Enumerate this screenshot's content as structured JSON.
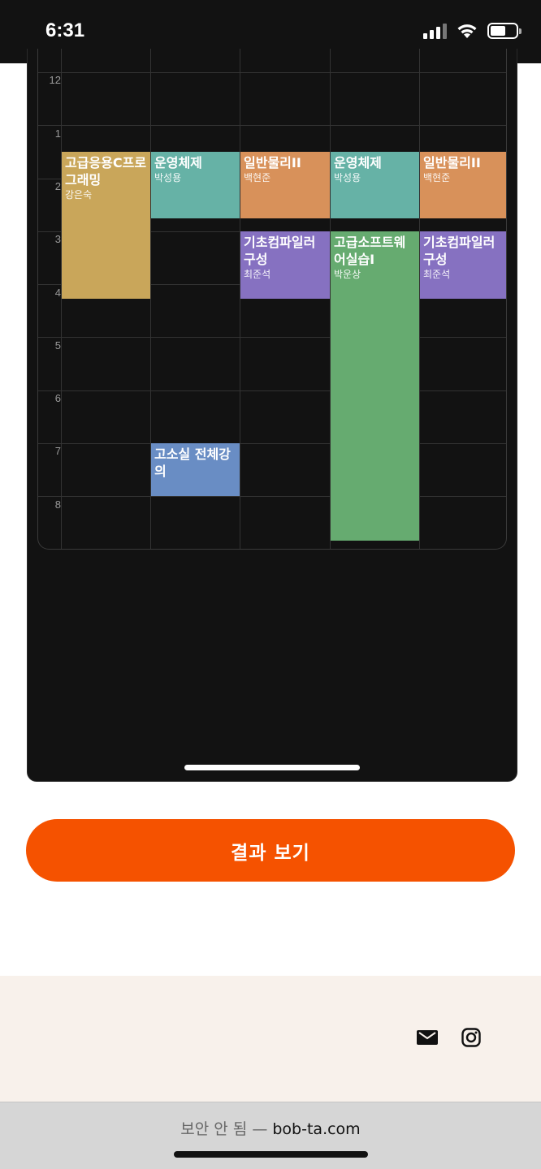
{
  "status_bar": {
    "time": "6:31"
  },
  "timetable": {
    "hours": [
      "12",
      "1",
      "2",
      "3",
      "4",
      "5",
      "6",
      "7",
      "8"
    ],
    "courses": [
      {
        "name": "고급응용C프로그래밍",
        "professor": "강은숙",
        "color": "#c9a65a"
      },
      {
        "name": "운영체제",
        "professor": "박성용",
        "color": "#66b2a6"
      },
      {
        "name": "일반물리II",
        "professor": "백현준",
        "color": "#d8915a"
      },
      {
        "name": "운영체제",
        "professor": "박성용",
        "color": "#66b2a6"
      },
      {
        "name": "일반물리II",
        "professor": "백현준",
        "color": "#d8915a"
      },
      {
        "name": "기초컴파일러구성",
        "professor": "최준석",
        "color": "#8671c1"
      },
      {
        "name": "고급소프트웨어실습I",
        "professor": "박운상",
        "color": "#66ab70"
      },
      {
        "name": "기초컴파일러구성",
        "professor": "최준석",
        "color": "#8671c1"
      },
      {
        "name": "고소실 전체강의",
        "professor": "",
        "color": "#698dc4"
      }
    ]
  },
  "result_button": {
    "label": "결과 보기",
    "color": "#f55200"
  },
  "footer": {
    "icons": [
      "mail-icon",
      "instagram-icon"
    ]
  },
  "browser": {
    "security_label": "보안 안 됨 —",
    "domain": "bob-ta.com"
  }
}
